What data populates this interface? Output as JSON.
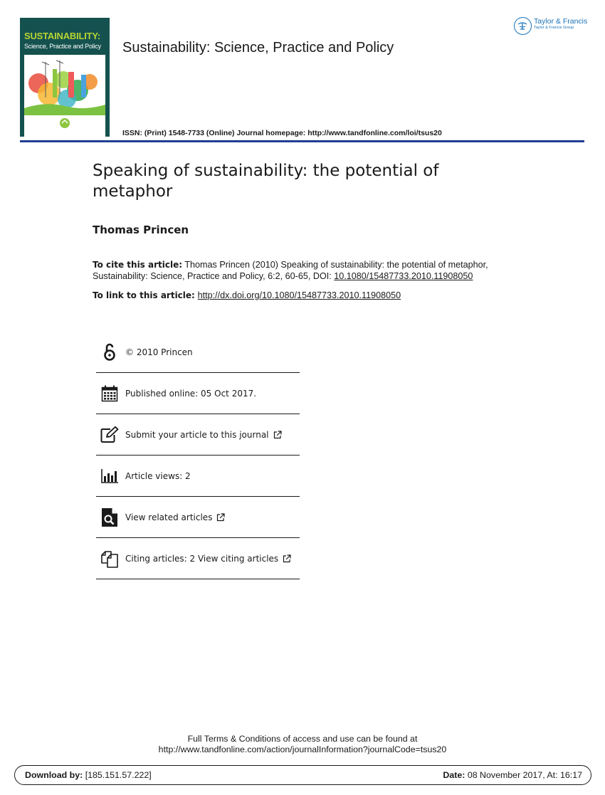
{
  "cover": {
    "title": "SUSTAINABILITY:",
    "subtitle": "Science, Practice and Policy",
    "publisher_mark": "Taylor & Francis"
  },
  "publisher_logo": {
    "name": "Taylor & Francis",
    "group": "Taylor & Francis Group",
    "color": "#1a73b8"
  },
  "journal": {
    "title": "Sustainability: Science, Practice and Policy",
    "issn_line": "ISSN: (Print) 1548-7733 (Online) Journal homepage: http://www.tandfonline.com/loi/tsus20"
  },
  "article": {
    "title": "Speaking of sustainability: the potential of metaphor",
    "author": "Thomas Princen"
  },
  "citation": {
    "label": "To cite this article:",
    "text": "Thomas Princen (2010) Speaking of sustainability: the potential of metaphor, Sustainability: Science, Practice and Policy, 6:2, 60-65, DOI:",
    "doi": "10.1080/15487733.2010.11908050",
    "link_label": "To link to this article:",
    "link_url": "http://dx.doi.org/10.1080/15487733.2010.11908050"
  },
  "info_items": [
    {
      "icon": "open-access-icon",
      "label": "© 2010 Princen",
      "external": false
    },
    {
      "icon": "calendar-icon",
      "label": "Published online: 05 Oct 2017.",
      "external": false
    },
    {
      "icon": "edit-icon",
      "label": "Submit your article to this journal",
      "external": true
    },
    {
      "icon": "bar-chart-icon",
      "label": "Article views: 2",
      "external": false
    },
    {
      "icon": "search-document-icon",
      "label": "View related articles",
      "external": true
    },
    {
      "icon": "citing-documents-icon",
      "label": "Citing articles: 2 View citing articles",
      "external": true
    }
  ],
  "footer": {
    "terms_line1": "Full Terms & Conditions of access and use can be found at",
    "terms_line2": "http://www.tandfonline.com/action/journalInformation?journalCode=tsus20",
    "download_label": "Download by:",
    "download_value": "[185.151.57.222]",
    "date_label": "Date:",
    "date_value": "08 November 2017, At: 16:17"
  },
  "colors": {
    "rule": "#1f3f93",
    "cover_bg": "#15524f",
    "cover_title": "#b8d432"
  }
}
